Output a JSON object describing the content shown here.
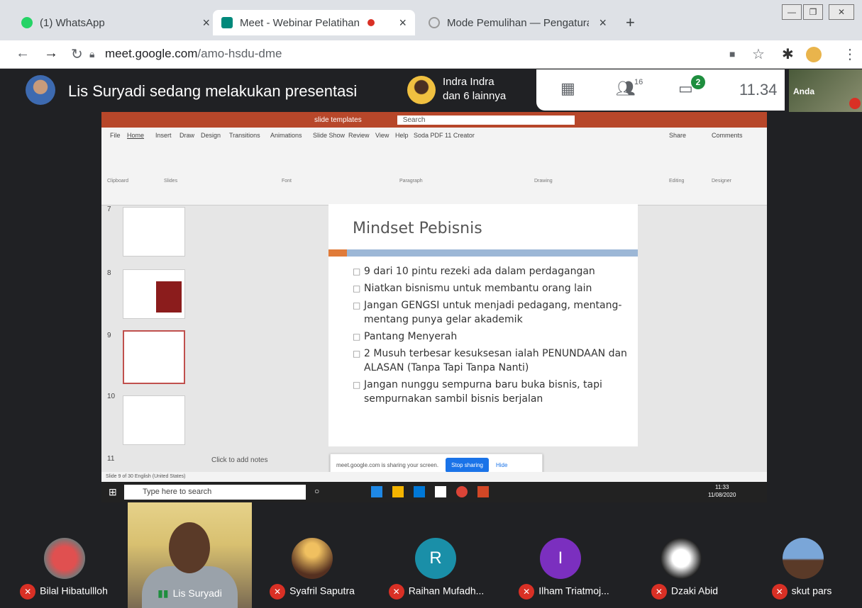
{
  "browser": {
    "tabs": [
      {
        "title": "(1) WhatsApp",
        "active": false
      },
      {
        "title": "Meet - Webinar Pelatihan Pe",
        "active": true
      },
      {
        "title": "Mode Pemulihan — Pengaturan",
        "active": false
      }
    ],
    "new_tab": "+",
    "url_host": "meet.google.com",
    "url_path": "/amo-hsdu-dme"
  },
  "meet": {
    "presenting_text": "Lis Suryadi sedang melakukan presentasi",
    "pinned_name_line1": "Indra Indra",
    "pinned_name_line2": "dan 6 lainnya",
    "participant_count": "16",
    "chat_badge": "2",
    "time": "11.34",
    "self_name": "Anda"
  },
  "powerpoint": {
    "title_center": "slide templates",
    "search_placeholder": "Search",
    "tabs": [
      "File",
      "Home",
      "Insert",
      "Draw",
      "Design",
      "Transitions",
      "Animations",
      "Slide Show",
      "Review",
      "View",
      "Help",
      "Soda PDF 11 Creator"
    ],
    "share": "Share",
    "comments": "Comments",
    "groups": [
      "Clipboard",
      "Slides",
      "Font",
      "Paragraph",
      "Drawing",
      "Editing",
      "Designer"
    ],
    "thumb_numbers": [
      "7",
      "8",
      "9",
      "10",
      "11"
    ],
    "slide": {
      "title": "Mindset Pebisnis",
      "bullets": [
        "9 dari 10 pintu rezeki ada dalam perdagangan",
        "Niatkan bisnismu untuk membantu orang lain",
        "Jangan GENGSI untuk menjadi pedagang, mentang-mentang punya gelar akademik",
        "Pantang Menyerah",
        "2 Musuh terbesar kesuksesan ialah PENUNDAAN dan ALASAN (Tanpa Tapi Tanpa Nanti)",
        "Jangan nunggu sempurna baru buka bisnis, tapi sempurnakan sambil bisnis berjalan"
      ]
    },
    "notes_placeholder": "Click to add notes",
    "share_bar_text": "meet.google.com is sharing your screen.",
    "stop_sharing": "Stop sharing",
    "hide": "Hide",
    "status_left": "Slide 9 of 30   English (United States)",
    "taskbar_search": "Type here to search",
    "taskbar_time": "11:33",
    "taskbar_date": "11/08/2020"
  },
  "participants": [
    {
      "name": "Bilal Hibatullloh",
      "muted": true,
      "initial": "",
      "color": "#b33"
    },
    {
      "name": "Lis Suryadi",
      "muted": false,
      "initial": "",
      "color": ""
    },
    {
      "name": "Syafril Saputra",
      "muted": true,
      "initial": "",
      "color": "#a86"
    },
    {
      "name": "Raihan Mufadh...",
      "muted": true,
      "initial": "R",
      "color": "#1a8fa8"
    },
    {
      "name": "Ilham Triatmoj...",
      "muted": true,
      "initial": "I",
      "color": "#7b2fbf"
    },
    {
      "name": "Dzaki Abid",
      "muted": true,
      "initial": "",
      "color": "#555"
    },
    {
      "name": "skut pars",
      "muted": true,
      "initial": "",
      "color": "#4a6a9a"
    }
  ]
}
